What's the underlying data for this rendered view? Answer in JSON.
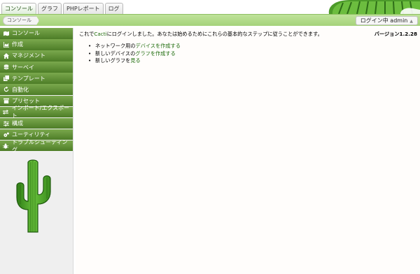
{
  "tabs": [
    {
      "label": "コンソール",
      "active": true
    },
    {
      "label": "グラフ",
      "active": false
    },
    {
      "label": "PHPレポート",
      "active": false
    },
    {
      "label": "ログ",
      "active": false
    }
  ],
  "breadcrumb": {
    "label": "コンソール"
  },
  "login": {
    "label": "ログイン中 admin"
  },
  "sidebar": {
    "items": [
      {
        "label": "コンソール",
        "icon": "map-icon"
      },
      {
        "label": "作成",
        "icon": "chart-icon"
      },
      {
        "label": "マネジメント",
        "icon": "home-icon"
      },
      {
        "label": "サーベイ",
        "icon": "database-icon"
      },
      {
        "label": "テンプレート",
        "icon": "copy-icon"
      },
      {
        "label": "自動化",
        "icon": "refresh-icon"
      },
      {
        "label": "プリセット",
        "icon": "archive-icon"
      },
      {
        "label": "インポート/エクスポート",
        "icon": "exchange-icon"
      },
      {
        "label": "構成",
        "icon": "sliders-icon"
      },
      {
        "label": "ユーティリティ",
        "icon": "cogs-icon"
      },
      {
        "label": "トラブルシューティング",
        "icon": "bug-icon"
      }
    ]
  },
  "main": {
    "welcome_pre": "これで",
    "welcome_brand": "Cacti",
    "welcome_post": "にログインしました。あなたは始めるためにこれらの基本的なステップに従うことができます。",
    "version": "バージョン1.2.28",
    "steps": [
      {
        "pre": "ネットワーク用の",
        "link": "デバイスを作成する"
      },
      {
        "pre": "新しいデバイスの",
        "link": "グラフを作成する"
      },
      {
        "pre": "新しいグラフを",
        "link": "見る"
      }
    ]
  },
  "colors": {
    "accent": "#4d7d27",
    "link": "#1e6c0c",
    "crumbbar": "#a5d27a"
  }
}
